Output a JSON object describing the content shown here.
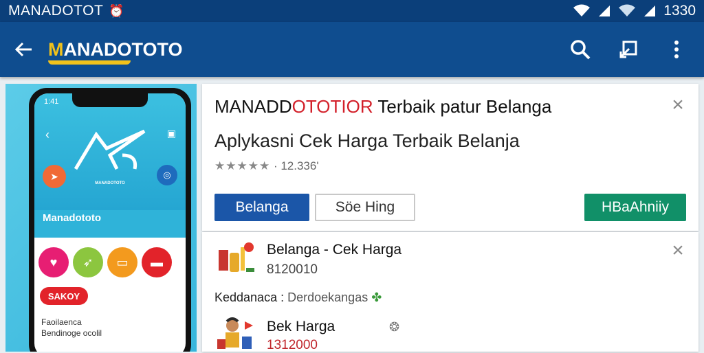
{
  "status_bar": {
    "title": "MANADOTOT",
    "time": "1330"
  },
  "app_bar": {
    "logo_first": "M",
    "logo_rest": "ANADOTOTO"
  },
  "phone": {
    "time": "1:41",
    "caption": "MANADOTOTO",
    "brand": "Manadototo",
    "pill": "SAKOY",
    "text_line1": "Faoilaenca",
    "text_line2": "Bendinoge ocolil",
    "circle_colors": [
      "#e71e73",
      "#8cc63f",
      "#f39a1e",
      "#e2232a"
    ]
  },
  "card1": {
    "title_black": "MANADD",
    "title_red": "OTOTIOR",
    "title_rest": " Terbaik patur Belanga",
    "subtitle": "Aplykasni Cek Harga Terbaik Belanja",
    "stars": "★★★★★",
    "rating": "· 12.336'",
    "btn_primary": "Belanga",
    "btn_secondary": "Söe Hing",
    "btn_install": "HBaAhniiy"
  },
  "card2": {
    "item1_title": "Belanga - Cek Harga",
    "item1_price": "8120010",
    "meta_label": "Keddanaca",
    "meta_value": "Derdoekangas",
    "item2_title": "Bek Harga",
    "item2_price": "1312000"
  },
  "colors": {
    "status_bg": "#0b3f7a",
    "appbar_bg": "#0f4d8f",
    "primary": "#1b56a8",
    "install": "#119068",
    "accent_red": "#d3202a",
    "logo_yellow": "#f2c21b"
  }
}
